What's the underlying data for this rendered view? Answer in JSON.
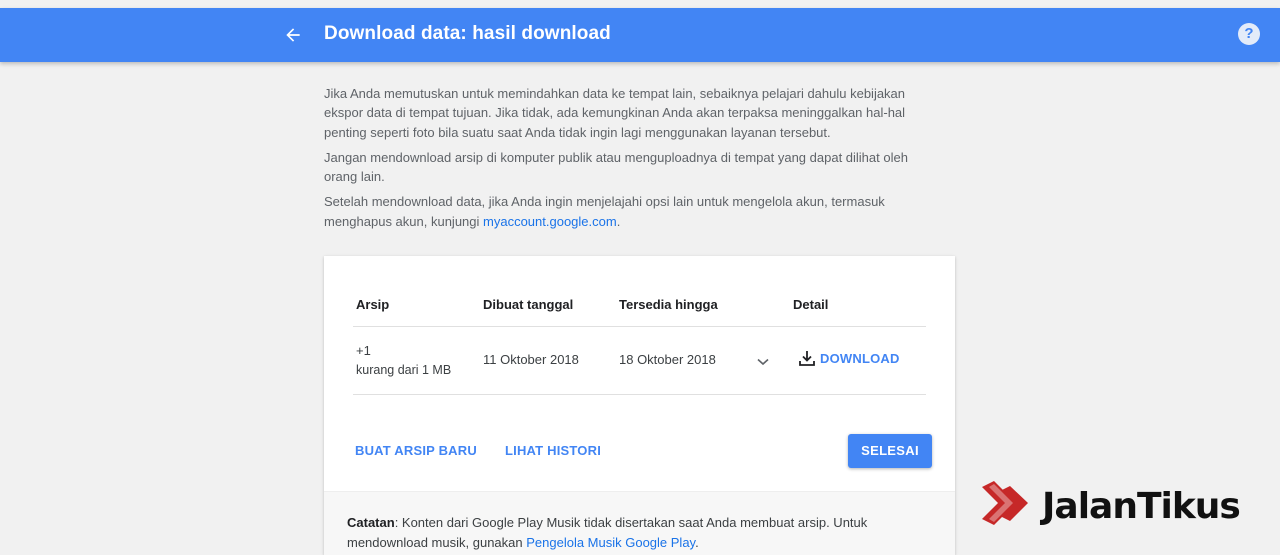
{
  "header": {
    "title": "Download data: hasil download",
    "back_icon": "arrow-back-icon",
    "help_icon": "help-icon",
    "help_glyph": "?",
    "bar_color": "#4285f4"
  },
  "intro": {
    "para1": "Jika Anda memutuskan untuk memindahkan data ke tempat lain, sebaiknya pelajari dahulu kebijakan ekspor data di tempat tujuan. Jika tidak, ada kemungkinan Anda akan terpaksa meninggalkan hal-hal penting seperti foto bila suatu saat Anda tidak ingin lagi menggunakan layanan tersebut.",
    "para2": "Jangan mendownload arsip di komputer publik atau menguploadnya di tempat yang dapat dilihat oleh orang lain.",
    "para3_prefix": "Setelah mendownload data, jika Anda ingin menjelajahi opsi lain untuk mengelola akun, termasuk menghapus akun, kunjungi",
    "para3_link": "myaccount.google.com",
    "para3_suffix": "."
  },
  "table": {
    "headers": [
      "Arsip",
      "Dibuat tanggal",
      "Tersedia hingga",
      "Detail"
    ],
    "rows": [
      {
        "archive_count": "+1",
        "archive_size": "kurang dari 1 MB",
        "created": "11 Oktober 2018",
        "available_until": "18 Oktober 2018",
        "action_label": "DOWNLOAD",
        "action_icon": "download-icon",
        "expand_icon": "chevron-down-icon"
      }
    ]
  },
  "actions": {
    "new_archive": "BUAT ARSIP BARU",
    "history": "LIHAT HISTORI",
    "done": "SELESAI"
  },
  "note": {
    "label": "Catatan",
    "text": ": Konten dari Google Play Musik tidak disertakan saat Anda membuat arsip. Untuk mendownload musik, gunakan",
    "link": "Pengelola Musik Google Play",
    "suffix": "."
  },
  "watermark": {
    "text": "JalanTikus",
    "accent": "#c62828"
  }
}
